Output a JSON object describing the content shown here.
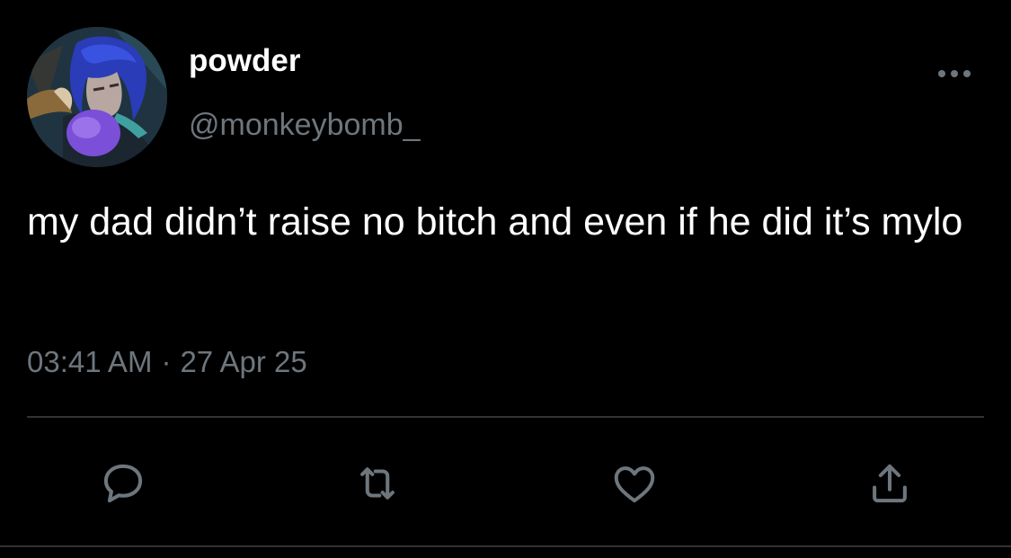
{
  "tweet": {
    "author": {
      "display_name": "powder",
      "handle": "@monkeybomb_",
      "avatar_icon": "profile-avatar"
    },
    "text": "my dad didn’t raise no bitch and even if he did it’s mylo",
    "time": "03:41 AM",
    "separator": "·",
    "date": "27 Apr 25",
    "more_icon": "ellipsis-icon"
  },
  "actions": [
    {
      "name": "reply",
      "icon": "reply-icon"
    },
    {
      "name": "retweet",
      "icon": "retweet-icon"
    },
    {
      "name": "like",
      "icon": "heart-icon"
    },
    {
      "name": "share",
      "icon": "share-icon"
    }
  ],
  "colors": {
    "background": "#000000",
    "primary_text": "#ffffff",
    "secondary_text": "#6e767d",
    "divider": "#2f3336",
    "icon": "#6e767d"
  }
}
